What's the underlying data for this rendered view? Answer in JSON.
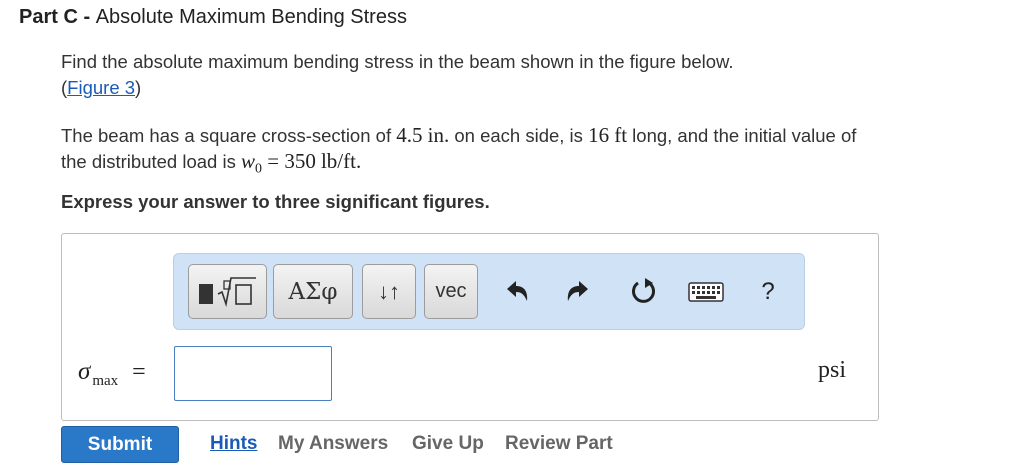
{
  "part": {
    "label": "Part C",
    "separator": " - ",
    "title": "Absolute Maximum Bending Stress"
  },
  "question": {
    "line1": "Find the absolute maximum bending stress in the beam shown in the figure below.",
    "figure_open": "(",
    "figure_link": "Figure 3",
    "figure_close": ")",
    "line2_a": "The beam has a square cross-section of ",
    "side_value": "4.5",
    "side_unit": "in.",
    "line2_b": " on each side, is ",
    "length_value": "16",
    "length_unit": "ft",
    "line2_c": " long, and the initial value of",
    "line3_a": "the distributed load is ",
    "w_symbol": "w",
    "w_subscript": "0",
    "w_equals": " = ",
    "w_value": "350",
    "w_unit": "lb/ft",
    "line3_end": "."
  },
  "instruction": "Express your answer to three significant figures.",
  "toolbar": {
    "greek_label": "ΑΣφ",
    "arrows_label": "↓↑",
    "vec_label": "vec",
    "help_label": "?",
    "icons": [
      "templates-icon",
      "undo-icon",
      "redo-icon",
      "reset-icon",
      "keyboard-icon",
      "help-icon"
    ]
  },
  "answer": {
    "symbol": "σ",
    "subscript": "max",
    "equals": "=",
    "value": "",
    "unit": "psi"
  },
  "actions": {
    "submit": "Submit",
    "hints": "Hints",
    "my_answers": "My Answers",
    "give_up": "Give Up",
    "review_part": "Review Part"
  },
  "colors": {
    "link": "#1a5bb8",
    "submit_bg": "#2a78c8",
    "toolbar_bg": "#cfe2f6",
    "input_border": "#4a7fc0"
  }
}
